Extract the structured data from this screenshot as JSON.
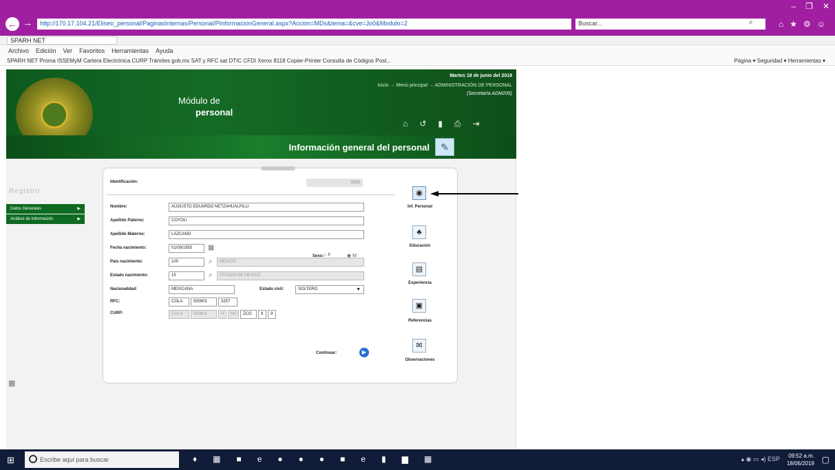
{
  "browser": {
    "address": "http://170.17.104.21/Eliseo_personal/PaginasInternas/Personal/PInformacionGeneral.aspx?Accion=MDs&tema=&cve=Jo0&Modulo=2",
    "search_placeholder": "Buscar...",
    "tab_title": "SPARH NET",
    "menu": [
      "Archivo",
      "Edición",
      "Ver",
      "Favoritos",
      "Herramientas",
      "Ayuda"
    ],
    "favorites": "SPARH NET   Proma ISSEMyM   Cartera Electrónica   CURP   Trámites gob.mx   SAT y RFC   sat DTIC   CFDI   Xerox 8118 Copier-Printer   Consulta de Códigos Post...",
    "tools": "Página ▾  Seguridad ▾  Herramientas ▾"
  },
  "header": {
    "module_small": "Módulo de",
    "module_big": "personal",
    "date": "Martes 18 de junio del 2019",
    "breadcrumb": "Inicio → Menú principal → ADMINISTRACIÓN DE PERSONAL",
    "user": "(Secretaría ADM205)",
    "title": "Información general del personal"
  },
  "sidebar": {
    "title": "Registro",
    "items": [
      {
        "label": "Datos Generales"
      },
      {
        "label": "Análisis de Información"
      }
    ]
  },
  "form": {
    "ident_label": "Identificación:",
    "ident_value": "0000",
    "nombre_label": "Nombre:",
    "nombre": "AUGUSTO EDUARDO NETZAHUALPILLI",
    "apaterno_label": "Apellido Paterno:",
    "apaterno": "COYOLI",
    "amaterno_label": "Apellido Materno:",
    "amaterno": "LAZCANO",
    "fnac_label": "Fecha nacimiento:",
    "fnac": "01/09/1955",
    "sexo_label": "Sexo:",
    "sexo_f": "F",
    "sexo_m": "M",
    "pais_label": "País nacimiento:",
    "pais_code": "100",
    "pais_name": "MEXICO",
    "estado_label": "Estado nacimiento:",
    "estado_code": "15",
    "estado_name": "ESTADO DE MEXICO",
    "nacionalidad_label": "Nacionalidad:",
    "nacionalidad": "MEXICANA",
    "civil_label": "Estado civil:",
    "civil": "SOLTERO",
    "rfc_label": "RFC:",
    "rfc": [
      "COLA",
      "550901",
      "3257"
    ],
    "curp_label": "CURP:",
    "curp": [
      "COLA",
      "550901",
      "H",
      "MC",
      "ZCG",
      "8",
      "9"
    ],
    "continue_label": "Continuar:"
  },
  "side_icons": [
    {
      "label": "Inf. Personal"
    },
    {
      "label": "Educación"
    },
    {
      "label": "Experiencia"
    },
    {
      "label": "Referencias"
    },
    {
      "label": "Observaciones"
    }
  ],
  "taskbar": {
    "search_placeholder": "Escribe aquí para buscar",
    "lang": "ESP",
    "time": "09:52 a.m.",
    "date": "18/06/2019"
  }
}
